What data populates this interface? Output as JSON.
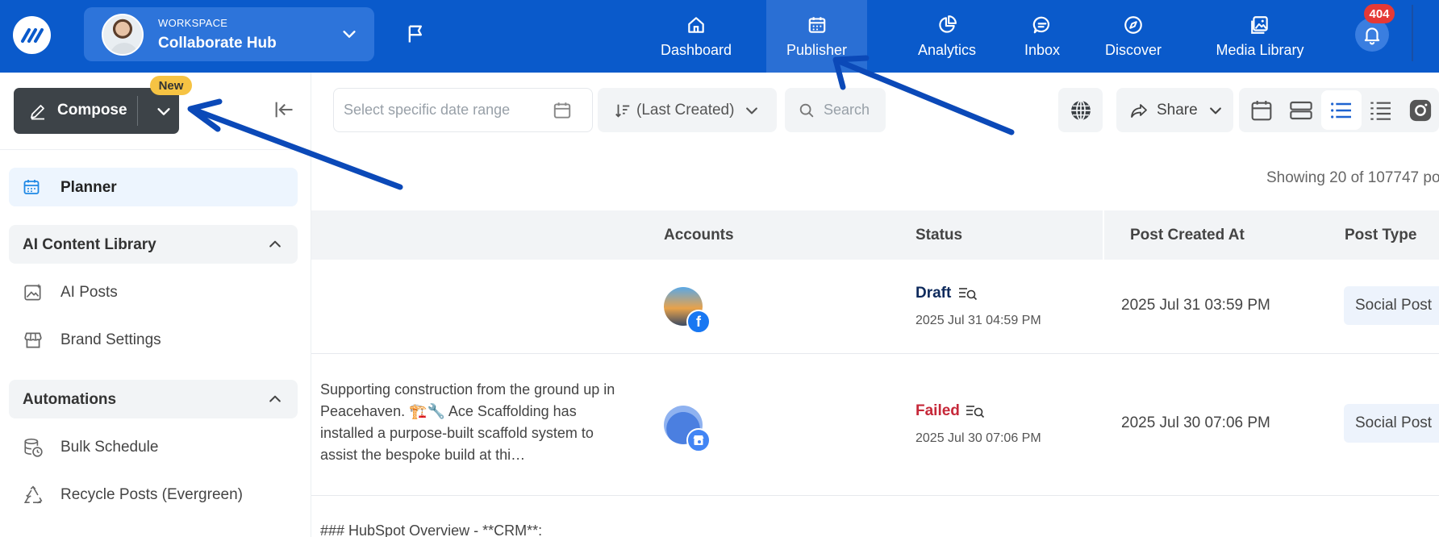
{
  "topbar": {
    "workspace_kicker": "WORKSPACE",
    "workspace_name": "Collaborate Hub",
    "nav": [
      {
        "label": "Dashboard",
        "icon": "home-icon"
      },
      {
        "label": "Publisher",
        "icon": "calendar-icon",
        "active": true
      },
      {
        "label": "Analytics",
        "icon": "pie-chart-icon"
      },
      {
        "label": "Inbox",
        "icon": "chat-icon"
      },
      {
        "label": "Discover",
        "icon": "compass-icon"
      },
      {
        "label": "Media Library",
        "icon": "image-icon"
      }
    ],
    "notification_count": "404",
    "accent": "#0A5ACB"
  },
  "toolbar": {
    "date_placeholder": "Select specific date range",
    "sort_label": "(Last Created)",
    "search_placeholder": "Search",
    "share_label": "Share"
  },
  "sidebar": {
    "compose_label": "Compose",
    "new_badge": "New",
    "planner_label": "Planner",
    "section_ai": "AI Content Library",
    "ai_posts": "AI Posts",
    "brand_settings": "Brand Settings",
    "section_automations": "Automations",
    "bulk_schedule": "Bulk Schedule",
    "recycle_posts": "Recycle Posts (Evergreen)"
  },
  "main": {
    "showing": "Showing 20 of 107747 po",
    "headers": {
      "accounts": "Accounts",
      "status": "Status",
      "created": "Post Created At",
      "type": "Post Type"
    },
    "rows": [
      {
        "text": "",
        "status": "Draft",
        "status_color": "#0E2A5C",
        "status_date": "2025 Jul 31 04:59 PM",
        "created": "2025 Jul 31 03:59 PM",
        "type": "Social Post",
        "network": "facebook"
      },
      {
        "text": "Supporting construction from the ground up in Peacehaven. 🏗️🔧 Ace Scaffolding has installed a purpose-built scaffold system to assist the bespoke build at thi…",
        "status": "Failed",
        "status_color": "#C62839",
        "status_date": "2025 Jul 30 07:06 PM",
        "created": "2025 Jul 30 07:06 PM",
        "type": "Social Post",
        "network": "google-business"
      },
      {
        "text": "### HubSpot Overview - **CRM**:"
      }
    ]
  }
}
